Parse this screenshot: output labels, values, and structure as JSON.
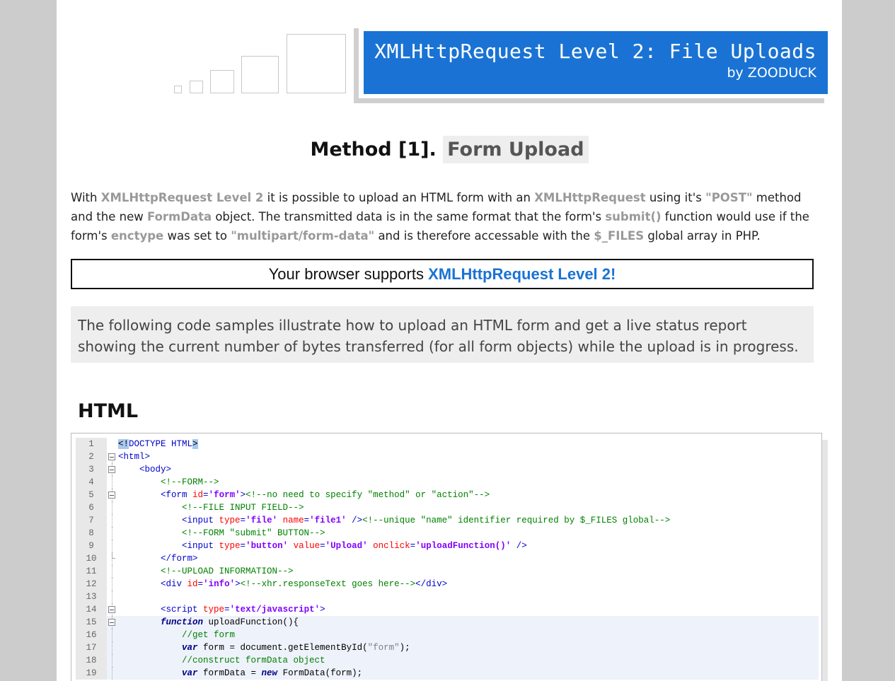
{
  "header": {
    "title": "XMLHttpRequest Level 2: File Uploads",
    "byline": "by ZOODUCK",
    "accent": "#1a73d4"
  },
  "method": {
    "prefix": "Method [1].",
    "label": "Form Upload"
  },
  "intro": {
    "t1": "With ",
    "h1": "XMLHttpRequest Level 2",
    "t2": " it is possible to upload an HTML form with an ",
    "h2": "XMLHttpRequest",
    "t3": " using it's ",
    "h3": "\"POST\"",
    "t4": " method and the new ",
    "h4": "FormData",
    "t5": " object. The transmitted data is in the same format that the form's ",
    "h5": "submit()",
    "t6": " function would use if the form's ",
    "h6": "enctype",
    "t7": " was set to ",
    "h7": "\"multipart/form-data\"",
    "t8": " and is therefore accessable with the ",
    "h8": "$_FILES",
    "t9": " global array in PHP."
  },
  "support": {
    "text": "Your browser supports ",
    "highlight": "XMLHttpRequest Level 2!"
  },
  "note": {
    "text": "The following code samples illustrate how to upload an HTML form and get a live status report showing the current number of bytes transferred (for all form objects) while the upload is in progress."
  },
  "section": {
    "heading": "HTML"
  },
  "code": {
    "lines": [
      {
        "n": "1",
        "fold": "none",
        "hi": false,
        "segs": [
          [
            "sel",
            "<!"
          ],
          [
            "t",
            "DOCTYPE HTML"
          ],
          [
            "sel",
            ">"
          ]
        ]
      },
      {
        "n": "2",
        "fold": "open",
        "hi": false,
        "segs": [
          [
            "t",
            "<html>"
          ]
        ]
      },
      {
        "n": "3",
        "fold": "open",
        "hi": false,
        "segs": [
          [
            "p",
            "    "
          ],
          [
            "t",
            "<body>"
          ]
        ]
      },
      {
        "n": "4",
        "fold": "line",
        "hi": false,
        "segs": [
          [
            "p",
            "        "
          ],
          [
            "c",
            "<!--FORM-->"
          ]
        ]
      },
      {
        "n": "5",
        "fold": "open",
        "hi": false,
        "segs": [
          [
            "p",
            "        "
          ],
          [
            "t",
            "<form "
          ],
          [
            "a",
            "id"
          ],
          [
            "t",
            "="
          ],
          [
            "v",
            "'form'"
          ],
          [
            "t",
            ">"
          ],
          [
            "c",
            "<!--no need to specify \"method\" or \"action\"-->"
          ]
        ]
      },
      {
        "n": "6",
        "fold": "line",
        "hi": false,
        "segs": [
          [
            "p",
            "            "
          ],
          [
            "c",
            "<!--FILE INPUT FIELD-->"
          ]
        ]
      },
      {
        "n": "7",
        "fold": "line",
        "hi": false,
        "segs": [
          [
            "p",
            "            "
          ],
          [
            "t",
            "<input "
          ],
          [
            "a",
            "type"
          ],
          [
            "t",
            "="
          ],
          [
            "v",
            "'file'"
          ],
          [
            "t",
            " "
          ],
          [
            "a",
            "name"
          ],
          [
            "t",
            "="
          ],
          [
            "v",
            "'file1'"
          ],
          [
            "t",
            " />"
          ],
          [
            "c",
            "<!--unique \"name\" identifier required by $_FILES global-->"
          ]
        ]
      },
      {
        "n": "8",
        "fold": "line",
        "hi": false,
        "segs": [
          [
            "p",
            "            "
          ],
          [
            "c",
            "<!--FORM \"submit\" BUTTON-->"
          ]
        ]
      },
      {
        "n": "9",
        "fold": "line",
        "hi": false,
        "segs": [
          [
            "p",
            "            "
          ],
          [
            "t",
            "<input "
          ],
          [
            "a",
            "type"
          ],
          [
            "t",
            "="
          ],
          [
            "v",
            "'button'"
          ],
          [
            "t",
            " "
          ],
          [
            "a",
            "value"
          ],
          [
            "t",
            "="
          ],
          [
            "v",
            "'Upload'"
          ],
          [
            "t",
            " "
          ],
          [
            "a",
            "onclick"
          ],
          [
            "t",
            "="
          ],
          [
            "v",
            "'uploadFunction()'"
          ],
          [
            "t",
            " />"
          ]
        ]
      },
      {
        "n": "10",
        "fold": "end",
        "hi": false,
        "segs": [
          [
            "p",
            "        "
          ],
          [
            "t",
            "</form>"
          ]
        ]
      },
      {
        "n": "11",
        "fold": "line",
        "hi": false,
        "segs": [
          [
            "p",
            "        "
          ],
          [
            "c",
            "<!--UPLOAD INFORMATION-->"
          ]
        ]
      },
      {
        "n": "12",
        "fold": "line",
        "hi": false,
        "segs": [
          [
            "p",
            "        "
          ],
          [
            "t",
            "<div "
          ],
          [
            "a",
            "id"
          ],
          [
            "t",
            "="
          ],
          [
            "v",
            "'info'"
          ],
          [
            "t",
            ">"
          ],
          [
            "c",
            "<!--xhr.responseText goes here-->"
          ],
          [
            "t",
            "</div>"
          ]
        ]
      },
      {
        "n": "13",
        "fold": "line",
        "hi": false,
        "segs": []
      },
      {
        "n": "14",
        "fold": "open",
        "hi": false,
        "segs": [
          [
            "p",
            "        "
          ],
          [
            "t",
            "<script "
          ],
          [
            "a",
            "type"
          ],
          [
            "t",
            "="
          ],
          [
            "v",
            "'text/javascript'"
          ],
          [
            "t",
            ">"
          ]
        ]
      },
      {
        "n": "15",
        "fold": "open",
        "hi": true,
        "segs": [
          [
            "p",
            "        "
          ],
          [
            "k",
            "function"
          ],
          [
            "p",
            " uploadFunction(){"
          ]
        ]
      },
      {
        "n": "16",
        "fold": "line",
        "hi": true,
        "segs": [
          [
            "p",
            "            "
          ],
          [
            "c",
            "//get form"
          ]
        ]
      },
      {
        "n": "17",
        "fold": "line",
        "hi": true,
        "segs": [
          [
            "p",
            "            "
          ],
          [
            "k",
            "var"
          ],
          [
            "p",
            " form = document.getElementById("
          ],
          [
            "s",
            "\"form\""
          ],
          [
            "p",
            ");"
          ]
        ]
      },
      {
        "n": "18",
        "fold": "line",
        "hi": true,
        "segs": [
          [
            "p",
            "            "
          ],
          [
            "c",
            "//construct formData object"
          ]
        ]
      },
      {
        "n": "19",
        "fold": "line",
        "hi": true,
        "segs": [
          [
            "p",
            "            "
          ],
          [
            "k",
            "var"
          ],
          [
            "p",
            " formData = "
          ],
          [
            "k",
            "new"
          ],
          [
            "p",
            " FormData(form);"
          ]
        ]
      }
    ]
  }
}
